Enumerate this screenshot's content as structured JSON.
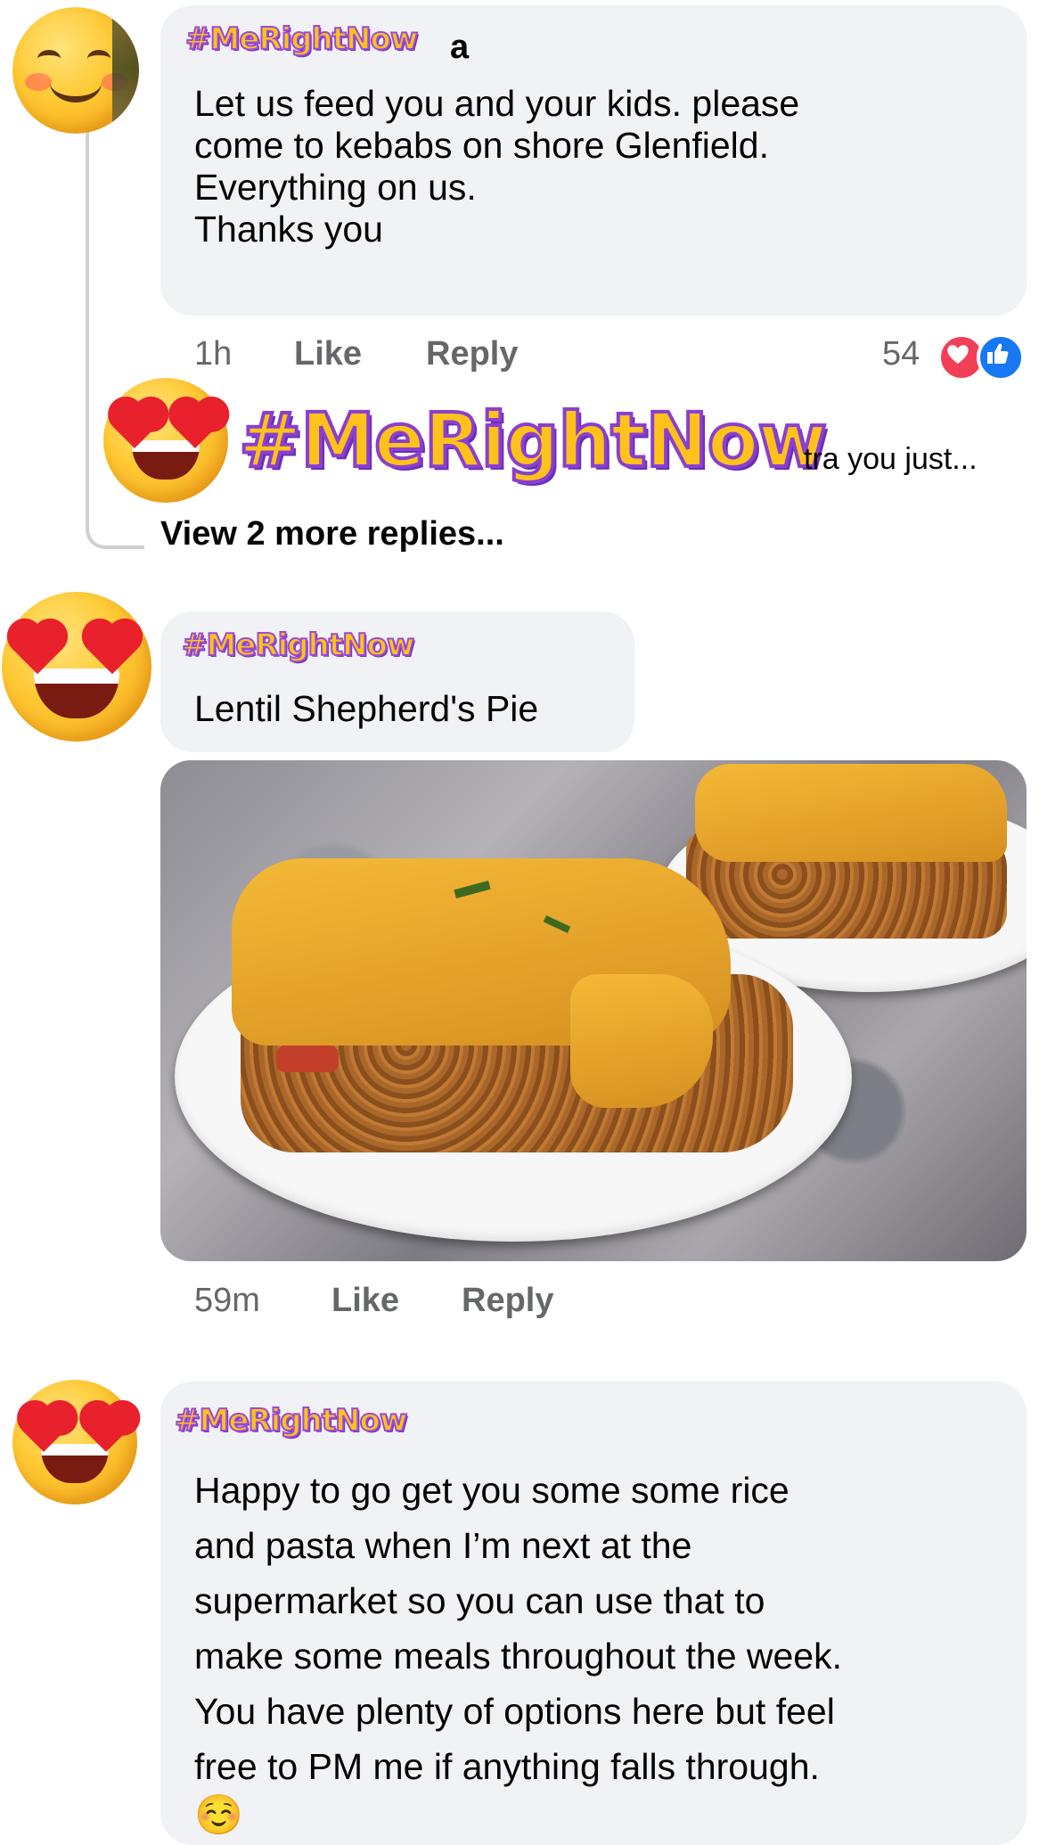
{
  "comments": [
    {
      "author_visible": "a",
      "text": "Let us feed you and your kids. please\ncome to kebabs on shore Glenfield.\nEverything on us.\nThanks you",
      "time": "1h",
      "like_label": "Like",
      "reply_label": "Reply",
      "reaction_count": "54",
      "reactions": [
        "heart-icon",
        "thumbs-up-icon"
      ],
      "avatar_icon": "smiling-face-icon"
    },
    {
      "author_visible": "",
      "text": "Lentil Shepherd's Pie",
      "time": "59m",
      "like_label": "Like",
      "reply_label": "Reply",
      "avatar_icon": "heart-eyes-face-icon",
      "photo_icon": "food-photo-icon"
    },
    {
      "author_visible": "",
      "text": "Happy to go get you some some rice\nand pasta when I’m next at the\nsupermarket so you can use that to\nmake some meals throughout the week.\nYou have plenty of options here but feel\nfree to PM me if anything falls through.",
      "emoji": "☺️",
      "avatar_icon": "heart-eyes-face-icon"
    }
  ],
  "reply_preview": {
    "text_visible": "tra you just...",
    "avatar_icon": "heart-eyes-face-icon"
  },
  "view_more_replies": "View 2 more replies...",
  "watermark_tag": "#MeRightNow",
  "colors": {
    "bubble": "#f0f2f5",
    "meta_text": "#65676b",
    "heart_reaction": "#f33e58",
    "like_reaction": "#1877f2",
    "tag_fill": "#ffc21a",
    "tag_outline": "#9b4bd8"
  }
}
